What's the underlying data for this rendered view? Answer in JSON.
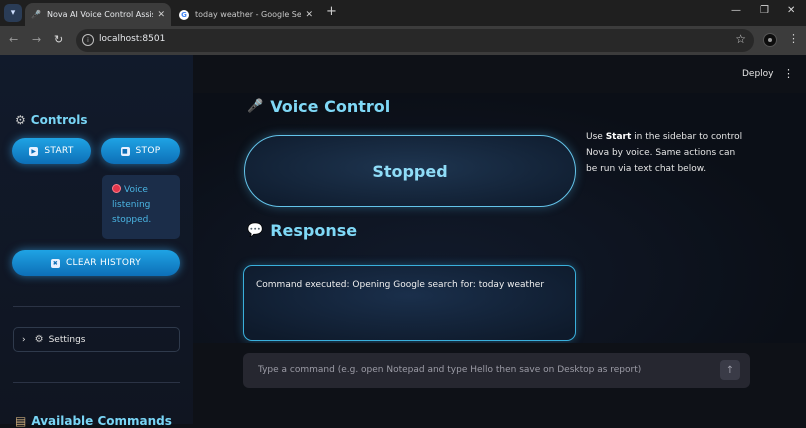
{
  "browser": {
    "tabs": [
      {
        "title": "Nova AI Voice Control Assistant",
        "icon": "microphone-icon",
        "active": true
      },
      {
        "title": "today weather - Google Search",
        "icon": "google-icon",
        "active": false
      }
    ],
    "url": "localhost:8501"
  },
  "app": {
    "deploy_label": "Deploy",
    "sidebar": {
      "controls_heading": "Controls",
      "start_label": "START",
      "stop_label": "STOP",
      "status_text": "Voice listening stopped.",
      "clear_label": "CLEAR HISTORY",
      "settings_label": "Settings",
      "commands_heading": "Available Commands"
    },
    "main": {
      "voice_heading": "Voice Control",
      "state_label": "Stopped",
      "help_prefix": "Use ",
      "help_bold": "Start",
      "help_suffix": " in the sidebar to control Nova by voice. Same actions can be run via text chat below.",
      "response_heading": "Response",
      "response_text": "Command executed: Opening Google search for: today weather",
      "chat_placeholder": "Type a command (e.g. open Notepad and type Hello then save on Desktop as report)"
    }
  },
  "colors": {
    "accent": "#7fd8f6",
    "button_gradient_top": "#1fa3e4",
    "button_gradient_bottom": "#0d6fb7",
    "status_dot": "#e3364b",
    "background": "#0e1117"
  }
}
